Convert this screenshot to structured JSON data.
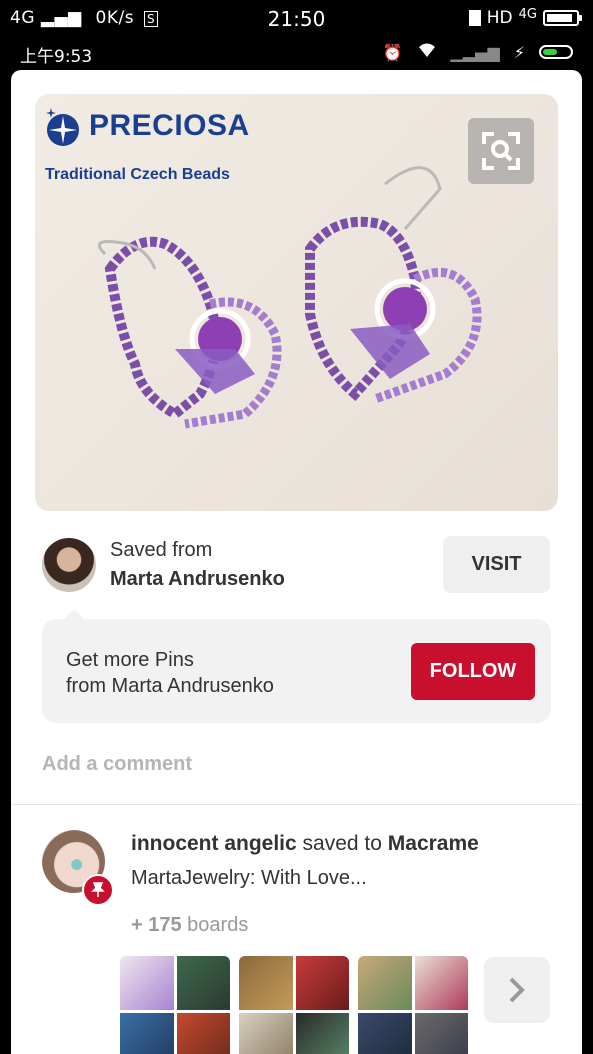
{
  "status_bar": {
    "network": "4G",
    "speed": "0K/s",
    "time": "21:50",
    "hd_label": "HD",
    "network_right": "4G",
    "secondary_time": "上午9:53",
    "battery_percent": 90,
    "battery2_percent": 60
  },
  "pin": {
    "brand_name": "PRECIOSA",
    "brand_tagline": "Traditional Czech Beads",
    "lens_icon": "visual-search-icon"
  },
  "source": {
    "saved_from_label": "Saved from",
    "author_name": "Marta Andrusenko",
    "visit_label": "VISIT"
  },
  "follow": {
    "line1": "Get more Pins",
    "line2": "from Marta Andrusenko",
    "button_label": "FOLLOW"
  },
  "comment": {
    "placeholder": "Add a comment"
  },
  "activity": {
    "user": "innocent angelic",
    "action": "saved to",
    "board": "Macrame",
    "description": "MartaJewelry: With Love...",
    "boards_prefix": "+ 175",
    "boards_label": "boards"
  },
  "colors": {
    "accent_red": "#c8102e",
    "brand_blue": "#1b3f8f"
  }
}
